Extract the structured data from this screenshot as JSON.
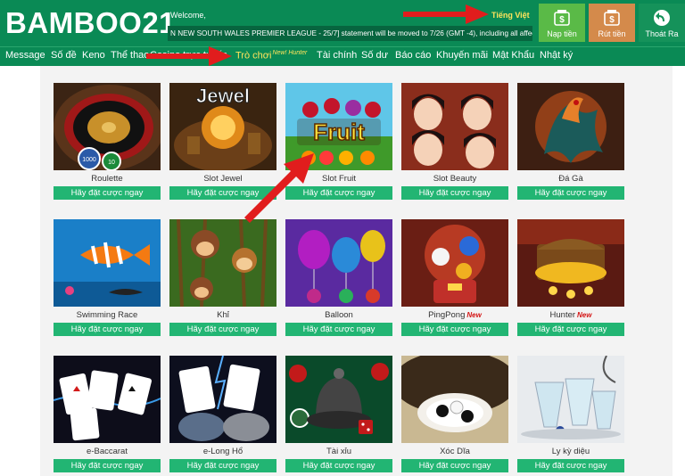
{
  "header": {
    "logo": "BAMBOO21",
    "welcome": "Welcome,",
    "language": "Tiếng Việt",
    "ticker": "N NEW SOUTH WALES PREMIER LEAGUE - 25/7] statement will be moved to 7/26 (GMT -4), including all affected",
    "deposit_label": "Nạp tiền",
    "withdraw_label": "Rút tiền",
    "logout_label": "Thoát Ra"
  },
  "nav": {
    "items": [
      "Message",
      "Số đề",
      "Keno",
      "Thể thao",
      "Casino trực tuyến",
      "Trò chơi",
      "Tài chính",
      "Số dư",
      "Báo cáo",
      "Khuyến mãi",
      "Mật Khẩu",
      "Nhật ký"
    ],
    "new_tag": "New! Hunter"
  },
  "games": [
    {
      "name": "Roulette",
      "cta": "Hãy đặt cược ngay",
      "new": ""
    },
    {
      "name": "Slot Jewel",
      "cta": "Hãy đặt cược ngay",
      "new": ""
    },
    {
      "name": "Slot Fruit",
      "cta": "Hãy đặt cược ngay",
      "new": ""
    },
    {
      "name": "Slot Beauty",
      "cta": "Hãy đặt cược ngay",
      "new": ""
    },
    {
      "name": "Đá Gà",
      "cta": "Hãy đặt cược ngay",
      "new": ""
    },
    {
      "name": "Swimming Race",
      "cta": "Hãy đặt cược ngay",
      "new": ""
    },
    {
      "name": "Khỉ",
      "cta": "Hãy đặt cược ngay",
      "new": ""
    },
    {
      "name": "Balloon",
      "cta": "Hãy đặt cược ngay",
      "new": ""
    },
    {
      "name": "PingPong",
      "cta": "Hãy đặt cược ngay",
      "new": "New"
    },
    {
      "name": "Hunter",
      "cta": "Hãy đặt cược ngay",
      "new": "New"
    },
    {
      "name": "e-Baccarat",
      "cta": "Hãy đặt cược ngay",
      "new": ""
    },
    {
      "name": "e-Long Hổ",
      "cta": "Hãy đặt cược ngay",
      "new": ""
    },
    {
      "name": "Tài xỉu",
      "cta": "Hãy đặt cược ngay",
      "new": ""
    },
    {
      "name": "Xóc Dĩa",
      "cta": "Hãy đặt cược ngay",
      "new": ""
    },
    {
      "name": "Ly kỳ diệu",
      "cta": "Hãy đặt cược ngay",
      "new": ""
    }
  ],
  "thumb_text": {
    "roulette_chip_1": "1000",
    "roulette_chip_2": "10",
    "jewel": "Jewel",
    "fruit": "Fruit"
  },
  "colors": {
    "header_bg": "#0a8a55",
    "cta_bg": "#22b573",
    "accent_yellow": "#ffe45c",
    "arrow_red": "#e11d1d",
    "new_red": "#d41515"
  },
  "icons": {
    "deposit": "wallet-dollar-icon",
    "withdraw": "wallet-dollar-icon",
    "logout": "logout-arrow-icon"
  }
}
